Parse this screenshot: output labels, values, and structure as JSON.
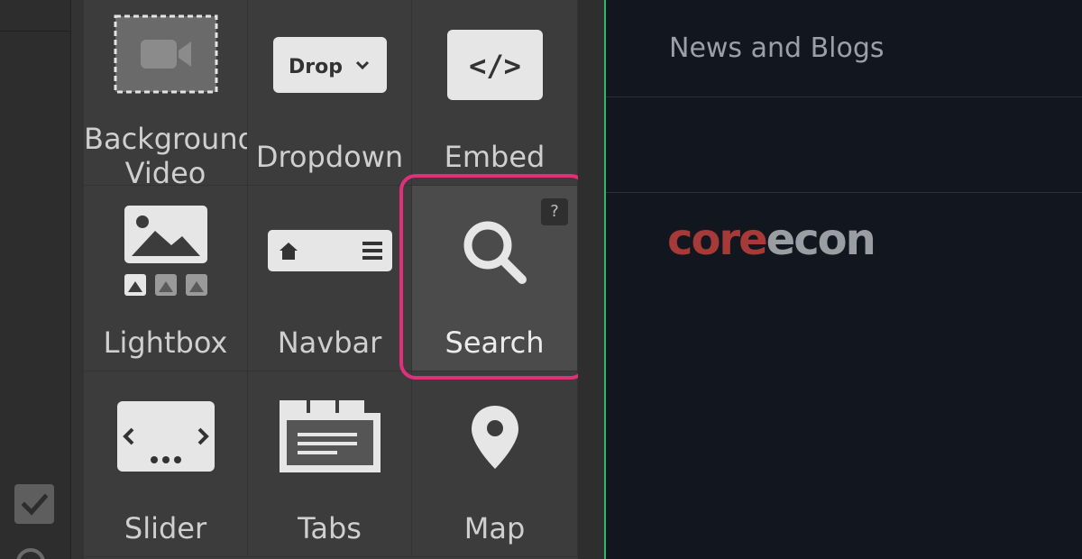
{
  "elements_panel": {
    "items": [
      {
        "label": "Background Video",
        "label_line1": "Background",
        "label_line2": "Video",
        "icon": "video-icon"
      },
      {
        "label": "Dropdown",
        "icon": "dropdown-icon",
        "icon_text": "Drop"
      },
      {
        "label": "Embed",
        "icon": "embed-icon",
        "icon_text": "</>"
      },
      {
        "label": "Lightbox",
        "icon": "lightbox-icon"
      },
      {
        "label": "Navbar",
        "icon": "navbar-icon"
      },
      {
        "label": "Search",
        "icon": "search-icon",
        "help": "?"
      },
      {
        "label": "Slider",
        "icon": "slider-icon"
      },
      {
        "label": "Tabs",
        "icon": "tabs-icon"
      },
      {
        "label": "Map",
        "icon": "map-pin-icon"
      }
    ],
    "highlighted_item": "Search",
    "highlight_color": "#e0307a"
  },
  "canvas": {
    "nav_link": "News and Blogs",
    "brand_part1": "core",
    "brand_part2": "econ",
    "brand_color_1": "#a63a38",
    "brand_color_2": "#9a9da2",
    "selection_border_color": "#2fb86a"
  }
}
